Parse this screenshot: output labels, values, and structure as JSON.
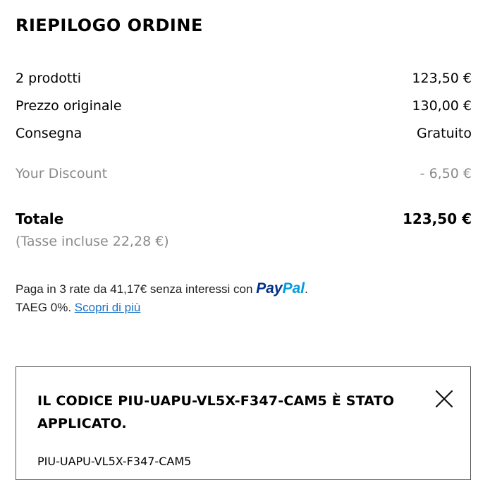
{
  "summary": {
    "title": "RIEPILOGO ORDINE",
    "products_label": "2 prodotti",
    "products_value": "123,50 €",
    "original_price_label": "Prezzo originale",
    "original_price_value": "130,00 €",
    "delivery_label": "Consegna",
    "delivery_value": "Gratuito",
    "discount_label": "Your Discount",
    "discount_value": "- 6,50 €",
    "total_label": "Totale",
    "total_value": "123,50 €",
    "tax_note": "(Tasse incluse  22,28 €)"
  },
  "paypal": {
    "line1": "Paga in 3 rate da 41,17€ senza interessi con",
    "logo_pay": "Pay",
    "logo_pal": "Pal",
    "period": ".",
    "line2": "TAEG 0%.",
    "learn_more": "Scopri di più",
    "colors": {
      "pay": "#003087",
      "pal": "#009cde",
      "link": "#1a73c9"
    }
  },
  "coupon": {
    "message": "IL CODICE PIU-UAPU-VL5X-F347-CAM5 È STATO APPLICATO.",
    "code": "PIU-UAPU-VL5X-F347-CAM5",
    "close_icon": "close-icon"
  }
}
